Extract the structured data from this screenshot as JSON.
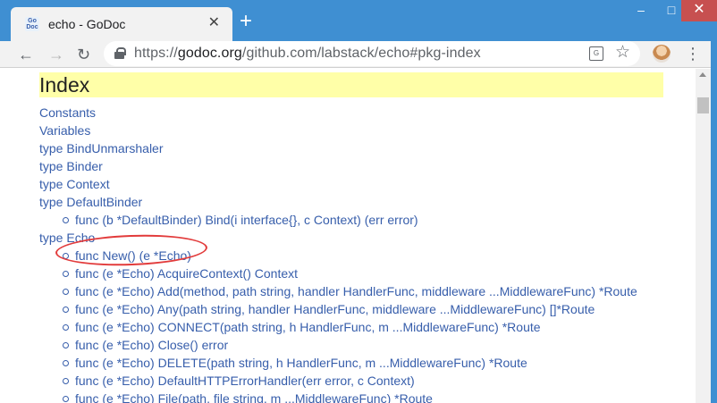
{
  "browser": {
    "tab_title": "echo - GoDoc",
    "tab_favicon_text": "Go Doc",
    "new_tab_symbol": "+",
    "window_min": "–",
    "window_max": "□",
    "window_close": "✕",
    "url_scheme": "https://",
    "url_host": "godoc.org",
    "url_path": "/github.com/labstack/echo#pkg-index",
    "icons": [
      "back-arrow",
      "forward-arrow",
      "reload",
      "lock",
      "translate",
      "star",
      "avatar",
      "kebab-menu"
    ]
  },
  "page": {
    "heading": "Index",
    "items": [
      {
        "text": "Constants",
        "level": 0
      },
      {
        "text": "Variables",
        "level": 0
      },
      {
        "text": "type BindUnmarshaler",
        "level": 0
      },
      {
        "text": "type Binder",
        "level": 0
      },
      {
        "text": "type Context",
        "level": 0
      },
      {
        "text": "type DefaultBinder",
        "level": 0
      },
      {
        "text": "func (b *DefaultBinder) Bind(i interface{}, c Context) (err error)",
        "level": 1
      },
      {
        "text": "type Echo",
        "level": 0
      },
      {
        "text": "func New() (e *Echo)",
        "level": 1
      },
      {
        "text": "func (e *Echo) AcquireContext() Context",
        "level": 1
      },
      {
        "text": "func (e *Echo) Add(method, path string, handler HandlerFunc, middleware ...MiddlewareFunc) *Route",
        "level": 1
      },
      {
        "text": "func (e *Echo) Any(path string, handler HandlerFunc, middleware ...MiddlewareFunc) []*Route",
        "level": 1
      },
      {
        "text": "func (e *Echo) CONNECT(path string, h HandlerFunc, m ...MiddlewareFunc) *Route",
        "level": 1
      },
      {
        "text": "func (e *Echo) Close() error",
        "level": 1
      },
      {
        "text": "func (e *Echo) DELETE(path string, h HandlerFunc, m ...MiddlewareFunc) *Route",
        "level": 1
      },
      {
        "text": "func (e *Echo) DefaultHTTPErrorHandler(err error, c Context)",
        "level": 1
      },
      {
        "text": "func (e *Echo) File(path, file string, m ...MiddlewareFunc) *Route",
        "level": 1
      }
    ],
    "colors": {
      "link": "#375eab",
      "heading_bg": "#ffffa8",
      "annotation": "#e23b3b"
    }
  }
}
